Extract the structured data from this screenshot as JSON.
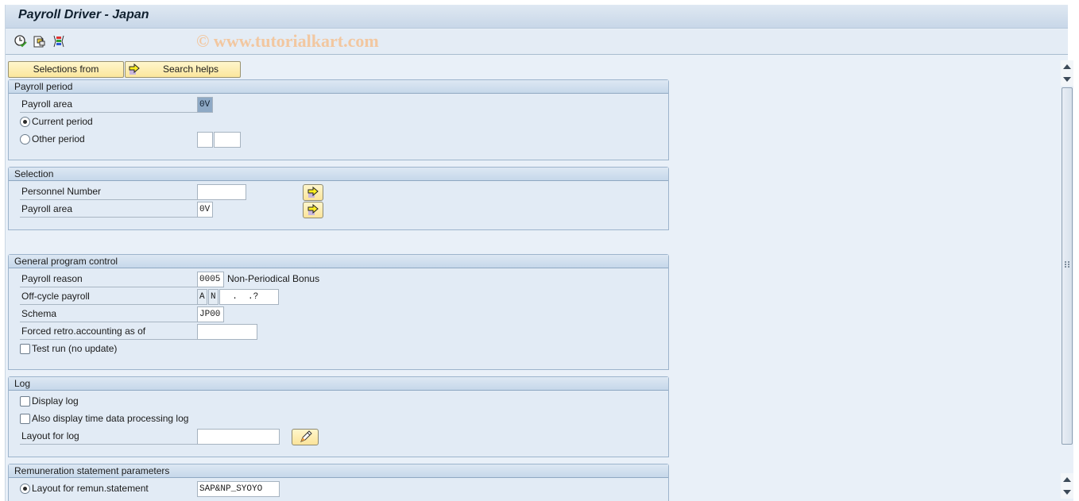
{
  "window": {
    "title": "Payroll Driver - Japan"
  },
  "toolbar": {
    "icons": [
      "execute-clock-icon",
      "get-variant-icon",
      "selection-options-icon"
    ],
    "watermark": "© www.tutorialkart.com"
  },
  "buttons": {
    "selections_from": "Selections from",
    "search_helps": "Search helps"
  },
  "payroll_period": {
    "title": "Payroll period",
    "payroll_area_label": "Payroll area",
    "payroll_area_value": "0V",
    "current_period_label": "Current period",
    "current_period_selected": true,
    "other_period_label": "Other period",
    "other_period_selected": false,
    "other_period_value1": "",
    "other_period_value2": ""
  },
  "selection": {
    "title": "Selection",
    "personnel_number_label": "Personnel Number",
    "personnel_number_value": "",
    "payroll_area_label": "Payroll area",
    "payroll_area_value": "0V"
  },
  "general": {
    "title": "General program control",
    "payroll_reason_label": "Payroll reason",
    "payroll_reason_value": "0005",
    "payroll_reason_text": "Non-Periodical Bonus",
    "offcycle_label": "Off-cycle payroll",
    "offcycle_a": "A",
    "offcycle_n": "N",
    "offcycle_date": "  .  .?",
    "schema_label": "Schema",
    "schema_value": "JP00",
    "forced_retro_label": "Forced retro.accounting as of",
    "forced_retro_value": "",
    "test_run_label": "Test run (no update)",
    "test_run_checked": false
  },
  "log": {
    "title": "Log",
    "display_log_label": "Display log",
    "display_log_checked": false,
    "time_log_label": "Also display time data processing log",
    "time_log_checked": false,
    "layout_label": "Layout for log",
    "layout_value": ""
  },
  "remuneration": {
    "title": "Remuneration statement parameters",
    "layout_label": "Layout for remun.statement",
    "layout_selected": true,
    "layout_value": "SAP&NP_SYOYO"
  }
}
